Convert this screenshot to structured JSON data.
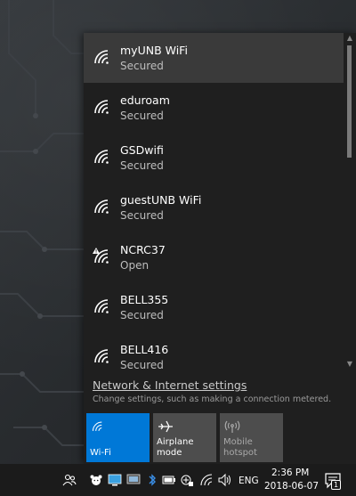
{
  "networks": [
    {
      "name": "myUNB WiFi",
      "status": "Secured"
    },
    {
      "name": "eduroam",
      "status": "Secured"
    },
    {
      "name": "GSDwifi",
      "status": "Secured"
    },
    {
      "name": "guestUNB WiFi",
      "status": "Secured"
    },
    {
      "name": "NCRC37",
      "status": "Open"
    },
    {
      "name": "BELL355",
      "status": "Secured"
    },
    {
      "name": "BELL416",
      "status": "Secured"
    }
  ],
  "settings": {
    "link": "Network & Internet settings",
    "description": "Change settings, such as making a connection metered."
  },
  "quick_actions": {
    "wifi": "Wi-Fi",
    "airplane": "Airplane mode",
    "hotspot_line1": "Mobile",
    "hotspot_line2": "hotspot"
  },
  "taskbar": {
    "language": "ENG",
    "time": "2:36 PM",
    "date": "2018-06-07",
    "notification_count": "1"
  },
  "colors": {
    "accent": "#0078d7",
    "flyout_bg": "#1f1f1f",
    "selected_bg": "#3a3a3a",
    "tile_bg": "#4d4d4d"
  }
}
